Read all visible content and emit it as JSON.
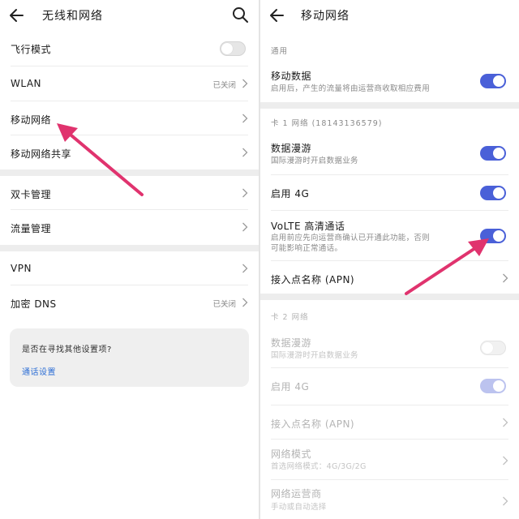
{
  "left": {
    "title": "无线和网络",
    "rows": [
      {
        "label": "飞行模式"
      },
      {
        "label": "WLAN",
        "value": "已关闭"
      },
      {
        "label": "移动网络"
      },
      {
        "label": "移动网络共享"
      },
      {
        "label": "双卡管理"
      },
      {
        "label": "流量管理"
      },
      {
        "label": "VPN"
      },
      {
        "label": "加密 DNS",
        "value": "已关闭"
      }
    ],
    "card": {
      "question": "是否在寻找其他设置项?",
      "link": "通话设置"
    }
  },
  "right": {
    "title": "移动网络",
    "section_general": "通用",
    "mobile_data": {
      "label": "移动数据",
      "sub": "启用后，产生的流量将由运营商收取相应费用",
      "on": true
    },
    "section_card1": "卡 1 网络 (18143136579)",
    "card1": {
      "roaming": {
        "label": "数据漫游",
        "sub": "国际漫游时开启数据业务",
        "on": true
      },
      "enable4g": {
        "label": "启用 4G",
        "on": true
      },
      "volte": {
        "label": "VoLTE 高清通话",
        "sub1": "启用前应先向运营商确认已开通此功能，否则",
        "sub2": "可能影响正常通话。",
        "on": true
      },
      "apn": {
        "label": "接入点名称 (APN)"
      }
    },
    "section_card2": "卡 2 网络",
    "card2": {
      "roaming": {
        "label": "数据漫游",
        "sub": "国际漫游时开启数据业务",
        "on": false
      },
      "enable4g": {
        "label": "启用 4G",
        "on": true
      },
      "apn": {
        "label": "接入点名称 (APN)"
      },
      "network_mode": {
        "label": "网络模式",
        "sub": "首选网络模式：4G/3G/2G"
      },
      "carrier": {
        "label": "网络运营商",
        "sub": "手动或自动选择"
      }
    }
  },
  "colors": {
    "accent": "#4a60d8",
    "annotation_arrow": "#e0336e",
    "link": "#2c6ed5"
  },
  "icons": [
    "back-arrow-icon",
    "search-icon",
    "chevron-right-icon",
    "annotation-arrow"
  ]
}
